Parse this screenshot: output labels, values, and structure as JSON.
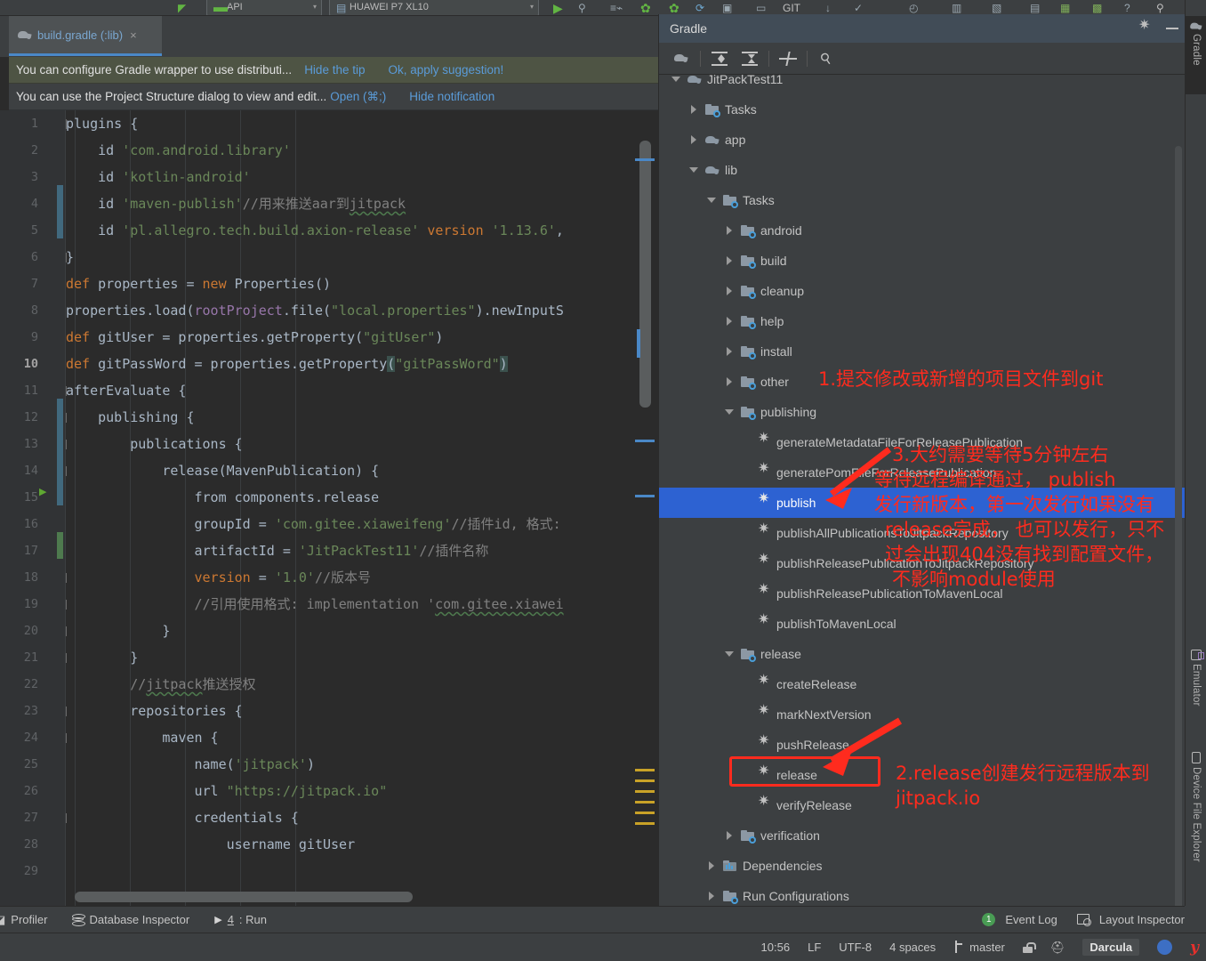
{
  "top_toolbar": {
    "api_combo": "API",
    "device_combo": "HUAWEI P7 XL10",
    "icons": [
      "back-arrow-icon",
      "sync-icon",
      "run-icon",
      "debug-icon",
      "profile-icon",
      "avd-icon"
    ]
  },
  "editor": {
    "tab": {
      "label": "build.gradle (:lib)",
      "icon": "gradle-elephant-icon",
      "close": "×"
    },
    "notifications": [
      {
        "message": "You can configure Gradle wrapper to use distributi...",
        "action1": "Hide the tip",
        "action2": "Ok, apply suggestion!"
      },
      {
        "message": "You can use the Project Structure dialog to view and edit...",
        "action1": "Open (⌘;)",
        "action2": "Hide notification"
      }
    ],
    "current_line": 10,
    "lines": [
      {
        "n": 1,
        "text": "plugins {"
      },
      {
        "n": 2,
        "text": "    id 'com.android.library'"
      },
      {
        "n": 3,
        "text": "    id 'kotlin-android'"
      },
      {
        "n": 4,
        "text": "    id 'maven-publish'//用来推送aar到jitpack"
      },
      {
        "n": 5,
        "text": "    id 'pl.allegro.tech.build.axion-release' version '1.13.6',"
      },
      {
        "n": 6,
        "text": "}"
      },
      {
        "n": 7,
        "text": "def properties = new Properties()"
      },
      {
        "n": 8,
        "text": "properties.load(rootProject.file(\"local.properties\").newInputS"
      },
      {
        "n": 9,
        "text": "def gitUser = properties.getProperty(\"gitUser\")"
      },
      {
        "n": 10,
        "text": "def gitPassWord = properties.getProperty(\"gitPassWord\")"
      },
      {
        "n": 11,
        "text": "afterEvaluate {"
      },
      {
        "n": 12,
        "text": "    publishing {"
      },
      {
        "n": 13,
        "text": "        publications {"
      },
      {
        "n": 14,
        "text": "            release(MavenPublication) {"
      },
      {
        "n": 15,
        "text": "                from components.release"
      },
      {
        "n": 16,
        "text": "                groupId = 'com.gitee.xiaweifeng'//插件id, 格式:"
      },
      {
        "n": 17,
        "text": "                artifactId = 'JitPackTest11'//插件名称"
      },
      {
        "n": 18,
        "text": "                version = '1.0'//版本号"
      },
      {
        "n": 19,
        "text": "                //引用使用格式: implementation 'com.gitee.xiawei"
      },
      {
        "n": 20,
        "text": "            }"
      },
      {
        "n": 21,
        "text": "        }"
      },
      {
        "n": 22,
        "text": "        //jitpack推送授权"
      },
      {
        "n": 23,
        "text": "        repositories {"
      },
      {
        "n": 24,
        "text": "            maven {"
      },
      {
        "n": 25,
        "text": "                name('jitpack')"
      },
      {
        "n": 26,
        "text": "                url \"https://jitpack.io\""
      },
      {
        "n": 27,
        "text": "                credentials {"
      },
      {
        "n": 28,
        "text": "                    username gitUser"
      },
      {
        "n": 29,
        "text": ""
      }
    ]
  },
  "gradle": {
    "title": "Gradle",
    "toolbar_icons": [
      "gradle-elephant-icon",
      "expand-all-icon",
      "collapse-all-icon",
      "toggle-offline-icon",
      "wrench-icon"
    ],
    "tree": [
      {
        "label": "JitPackTest11",
        "indent": 0,
        "type": "project",
        "state": "open"
      },
      {
        "label": "Tasks",
        "indent": 1,
        "type": "folder",
        "state": "closed"
      },
      {
        "label": "app",
        "indent": 1,
        "type": "module",
        "state": "closed"
      },
      {
        "label": "lib",
        "indent": 1,
        "type": "module",
        "state": "open"
      },
      {
        "label": "Tasks",
        "indent": 2,
        "type": "folder",
        "state": "open"
      },
      {
        "label": "android",
        "indent": 3,
        "type": "folder",
        "state": "closed"
      },
      {
        "label": "build",
        "indent": 3,
        "type": "folder",
        "state": "closed"
      },
      {
        "label": "cleanup",
        "indent": 3,
        "type": "folder",
        "state": "closed"
      },
      {
        "label": "help",
        "indent": 3,
        "type": "folder",
        "state": "closed"
      },
      {
        "label": "install",
        "indent": 3,
        "type": "folder",
        "state": "closed"
      },
      {
        "label": "other",
        "indent": 3,
        "type": "folder",
        "state": "closed"
      },
      {
        "label": "publishing",
        "indent": 3,
        "type": "folder",
        "state": "open"
      },
      {
        "label": "generateMetadataFileForReleasePublication",
        "indent": 4,
        "type": "task"
      },
      {
        "label": "generatePomFileForReleasePublication",
        "indent": 4,
        "type": "task"
      },
      {
        "label": "publish",
        "indent": 4,
        "type": "task",
        "selected": true
      },
      {
        "label": "publishAllPublicationsToJitpackRepository",
        "indent": 4,
        "type": "task"
      },
      {
        "label": "publishReleasePublicationToJitpackRepository",
        "indent": 4,
        "type": "task"
      },
      {
        "label": "publishReleasePublicationToMavenLocal",
        "indent": 4,
        "type": "task"
      },
      {
        "label": "publishToMavenLocal",
        "indent": 4,
        "type": "task"
      },
      {
        "label": "release",
        "indent": 3,
        "type": "folder",
        "state": "open"
      },
      {
        "label": "createRelease",
        "indent": 4,
        "type": "task"
      },
      {
        "label": "markNextVersion",
        "indent": 4,
        "type": "task"
      },
      {
        "label": "pushRelease",
        "indent": 4,
        "type": "task"
      },
      {
        "label": "release",
        "indent": 4,
        "type": "task",
        "boxed": true
      },
      {
        "label": "verifyRelease",
        "indent": 4,
        "type": "task"
      },
      {
        "label": "verification",
        "indent": 3,
        "type": "folder",
        "state": "closed"
      },
      {
        "label": "Dependencies",
        "indent": 2,
        "type": "deps",
        "state": "closed"
      },
      {
        "label": "Run Configurations",
        "indent": 2,
        "type": "folder",
        "state": "closed"
      }
    ]
  },
  "annotations": [
    {
      "id": "anno-1",
      "text": "1.提交修改或新增的项目文件到git"
    },
    {
      "id": "anno-2",
      "text": "2.release创建发行远程版本到"
    },
    {
      "id": "anno-2b",
      "text": "jitpack.io"
    },
    {
      "id": "anno-3-l1",
      "text": "3.大约需要等待5分钟左右"
    },
    {
      "id": "anno-3-l2",
      "text": "等待远程编译通过， publish"
    },
    {
      "id": "anno-3-l3",
      "text": "发行新版本，第一次发行如果没有"
    },
    {
      "id": "anno-3-l4",
      "text": "release完成， 也可以发行，只不"
    },
    {
      "id": "anno-3-l5",
      "text": "过会出现404没有找到配置文件，"
    },
    {
      "id": "anno-3-l6",
      "text": "不影响module使用"
    }
  ],
  "right_strip": {
    "gradle": "Gradle",
    "emulator": "Emulator",
    "device_file_explorer": "Device File Explorer"
  },
  "bottom_tools": {
    "profiler": "Profiler",
    "database_inspector": "Database Inspector",
    "run_num": "4",
    "run_label": ": Run",
    "event_log": "Event Log",
    "event_log_count": "1",
    "layout_inspector": "Layout Inspector"
  },
  "status_bar": {
    "time": "10:56",
    "line_sep": "LF",
    "encoding": "UTF-8",
    "indent": "4 spaces",
    "branch": "master",
    "theme": "Darcula"
  },
  "colors": {
    "accent_blue": "#2d62d2",
    "annotation_red": "#ff2b1e",
    "tab_underline": "#4a88c7",
    "editor_bg": "#2b2b2b",
    "panel_bg": "#3c3f41",
    "title_bg": "#414c57"
  }
}
